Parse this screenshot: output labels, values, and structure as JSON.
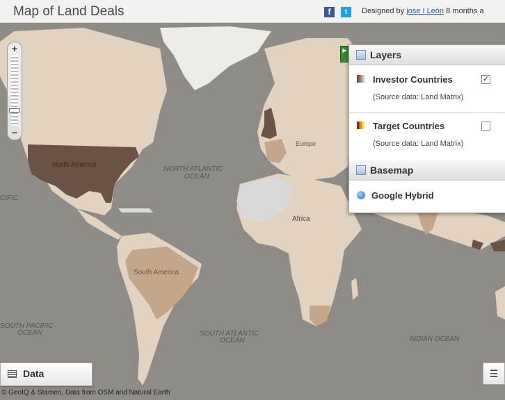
{
  "header": {
    "title": "Map of Land Deals",
    "facebook_glyph": "f",
    "twitter_glyph": "t",
    "credit_prefix": "Designed by",
    "credit_author": "jose I León",
    "credit_suffix": "8 months a"
  },
  "map": {
    "labels": {
      "north_america": "North America",
      "europe": "Europe",
      "africa": "Africa",
      "south_america": "South America",
      "north_atlantic_1": "NORTH ATLANTIC",
      "north_atlantic_2": "OCEAN",
      "south_pacific_1": "SOUTH PACIFIC",
      "south_pacific_2": "OCEAN",
      "south_atlantic_1": "SOUTH ATLANTIC",
      "south_atlantic_2": "OCEAN",
      "indian_ocean": "INDIAN OCEAN",
      "pacific_partial": "CIFIC"
    },
    "colors": {
      "ocean": "#8f8b87",
      "land": "#e2d3c0",
      "land_light": "#d9d9d9",
      "investor_dark": "#6b5247",
      "target_medium": "#c4a78a",
      "greenland": "#ecebe6"
    },
    "zoom": {
      "plus": "+",
      "minus": "−",
      "level": 0.8
    },
    "attribution": "© GeoIQ & Stamen, Data from OSM and Natural Earth"
  },
  "layers_panel": {
    "title": "Layers",
    "investor": {
      "label": "Investor Countries",
      "source": "(Source data: Land Matrix)",
      "checked": true,
      "check_glyph": "✓"
    },
    "target": {
      "label": "Target Countries",
      "source": "(Source data: Land Matrix)",
      "checked": false,
      "check_glyph": ""
    },
    "basemap_title": "Basemap",
    "basemap_option": "Google Hybrid",
    "toggle_glyph": "▶"
  },
  "data_button": {
    "label": "Data"
  },
  "list_button": {
    "glyph": "☰"
  }
}
